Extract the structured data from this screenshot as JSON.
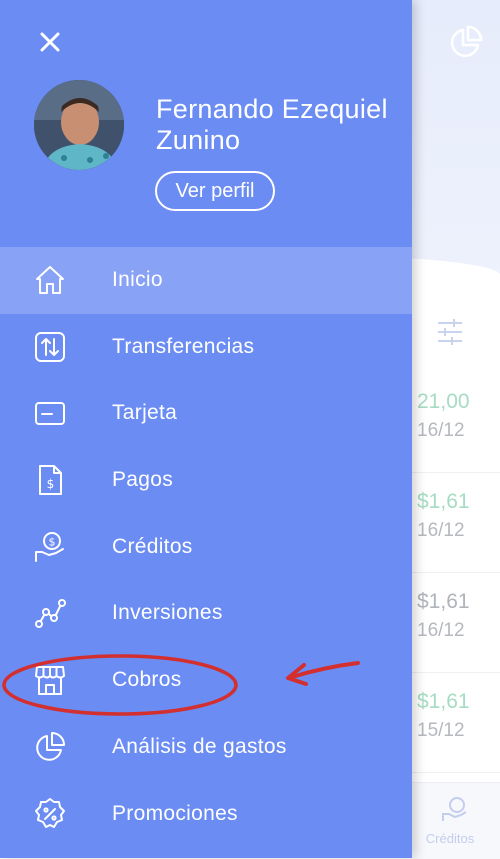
{
  "background": {
    "rows": [
      {
        "amount": "21,00",
        "date": "16/12",
        "tone": "green"
      },
      {
        "amount": "$1,61",
        "date": "16/12",
        "tone": "green"
      },
      {
        "amount": "$1,61",
        "date": "16/12",
        "tone": "grey"
      },
      {
        "amount": "$1,61",
        "date": "15/12",
        "tone": "green"
      }
    ],
    "bottom_nav_label": "Créditos"
  },
  "drawer": {
    "user_name": "Fernando Ezequiel Zunino",
    "profile_button": "Ver perfil",
    "accent_color": "#6b8cf3",
    "active_index": 0,
    "items": [
      {
        "label": "Inicio",
        "icon": "home-icon"
      },
      {
        "label": "Transferencias",
        "icon": "transfer-icon"
      },
      {
        "label": "Tarjeta",
        "icon": "card-icon"
      },
      {
        "label": "Pagos",
        "icon": "bill-icon"
      },
      {
        "label": "Créditos",
        "icon": "credit-hand-icon"
      },
      {
        "label": "Inversiones",
        "icon": "investment-chart-icon"
      },
      {
        "label": "Cobros",
        "icon": "store-icon"
      },
      {
        "label": "Análisis de gastos",
        "icon": "pie-chart-icon"
      },
      {
        "label": "Promociones",
        "icon": "promo-badge-icon"
      }
    ]
  },
  "annotation": {
    "color": "#d32f2f",
    "highlighted_item": "Cobros"
  }
}
